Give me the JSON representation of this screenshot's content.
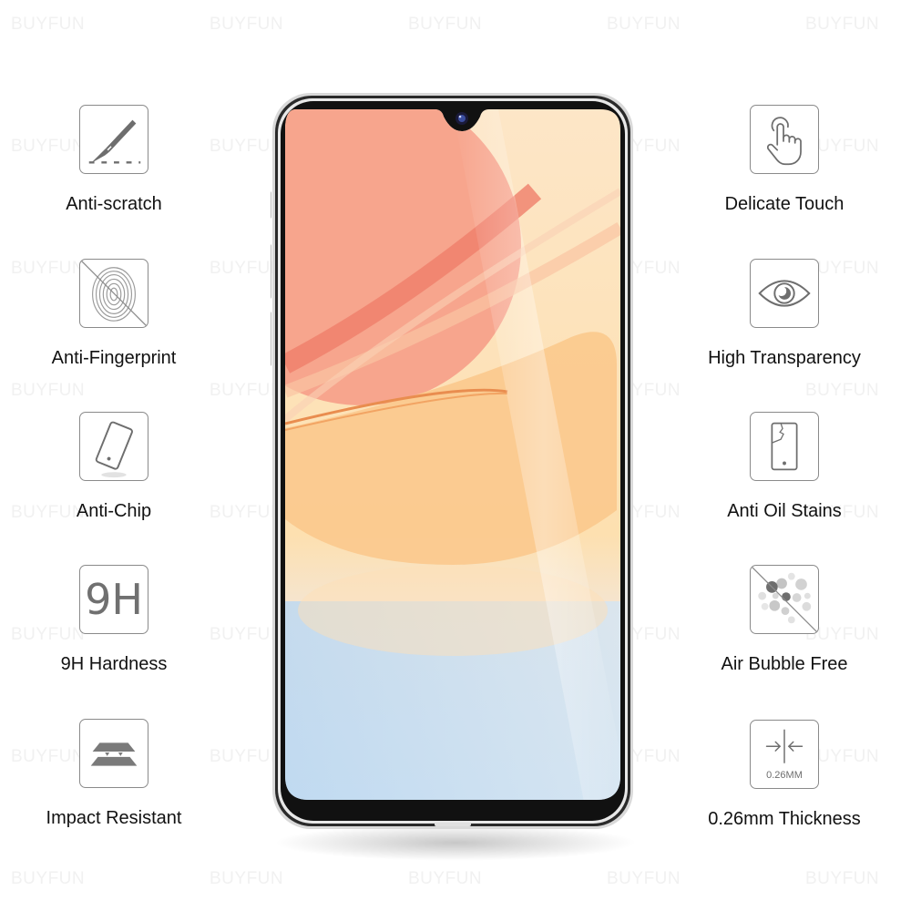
{
  "watermark": "BUYFUN",
  "left_features": [
    {
      "label": "Anti-scratch",
      "icon": "scalpel-icon"
    },
    {
      "label": "Anti-Fingerprint",
      "icon": "fingerprint-crossed-icon"
    },
    {
      "label": "Anti-Chip",
      "icon": "tilted-phone-icon"
    },
    {
      "label": "9H Hardness",
      "icon": "9h-text-icon",
      "icon_text": "9H"
    },
    {
      "label": "Impact Resistant",
      "icon": "stacked-layers-icon"
    }
  ],
  "right_features": [
    {
      "label": "Delicate Touch",
      "icon": "touch-hand-icon"
    },
    {
      "label": "High Transparency",
      "icon": "eye-icon"
    },
    {
      "label": "Anti Oil Stains",
      "icon": "cracked-phone-icon"
    },
    {
      "label": "Air Bubble Free",
      "icon": "bubbles-crossed-icon"
    },
    {
      "label": "0.26mm Thickness",
      "icon": "thickness-arrows-icon",
      "icon_text": "0.26MM"
    }
  ],
  "colors": {
    "icon_stroke": "#8a8a8a",
    "icon_fill": "#7a7a7a",
    "label_text": "#111111",
    "watermark": "#f1f1f1",
    "screen_pink": "#f7a58d",
    "screen_peach": "#fbd9a9",
    "screen_blue": "#c5def3"
  }
}
